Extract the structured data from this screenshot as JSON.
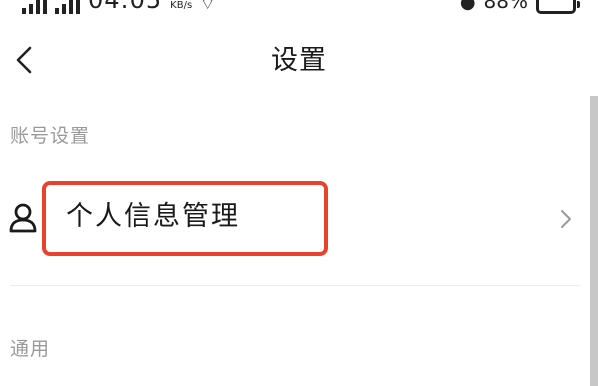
{
  "status_bar": {
    "time": "04:05",
    "speed": "KB/s",
    "battery": "88%"
  },
  "header": {
    "title": "设置"
  },
  "sections": {
    "account": {
      "label": "账号设置",
      "items": [
        {
          "label": "个人信息管理",
          "icon": "user-icon"
        }
      ]
    },
    "general": {
      "label": "通用"
    }
  },
  "colors": {
    "highlight": "#e8412c",
    "section_label": "#9a9a9a",
    "text": "#1a1a1a"
  }
}
